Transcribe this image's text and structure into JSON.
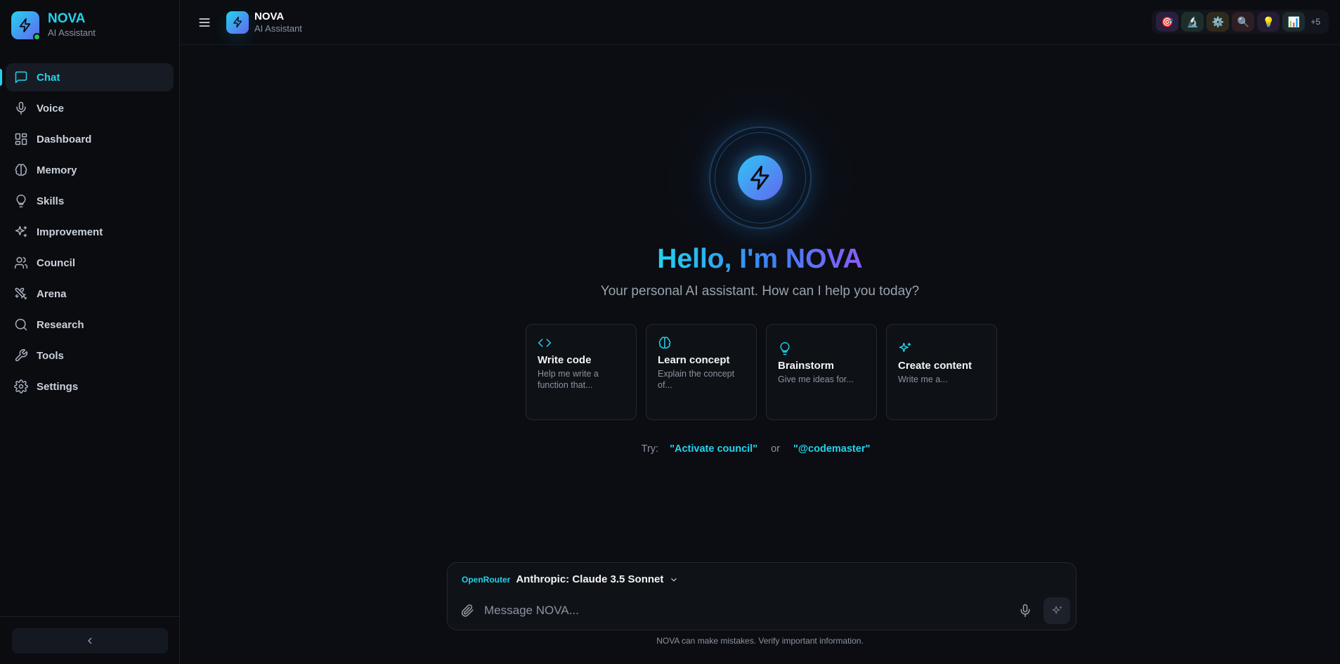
{
  "brand": {
    "title": "NOVA",
    "subtitle": "AI Assistant"
  },
  "sidebar": {
    "items": [
      {
        "label": "Chat",
        "icon": "message-square-icon",
        "active": true
      },
      {
        "label": "Voice",
        "icon": "mic-icon"
      },
      {
        "label": "Dashboard",
        "icon": "layout-grid-icon"
      },
      {
        "label": "Memory",
        "icon": "brain-icon"
      },
      {
        "label": "Skills",
        "icon": "lightbulb-icon"
      },
      {
        "label": "Improvement",
        "icon": "sparkles-icon"
      },
      {
        "label": "Council",
        "icon": "users-icon"
      },
      {
        "label": "Arena",
        "icon": "swords-icon"
      },
      {
        "label": "Research",
        "icon": "search-icon"
      },
      {
        "label": "Tools",
        "icon": "wrench-icon"
      },
      {
        "label": "Settings",
        "icon": "gear-icon"
      }
    ],
    "collapse_icon": "chevron-left-icon"
  },
  "topbar": {
    "title": "NOVA",
    "subtitle": "AI Assistant",
    "agents": [
      {
        "icon": "🎯",
        "bg": "#2a1f3d"
      },
      {
        "icon": "🔬",
        "bg": "#1d2e2a"
      },
      {
        "icon": "⚙️",
        "bg": "#2e2a1d"
      },
      {
        "icon": "🔍",
        "bg": "#2e1d24"
      },
      {
        "icon": "💡",
        "bg": "#251d33"
      },
      {
        "icon": "📊",
        "bg": "#1d2a2e"
      }
    ],
    "agents_more": "+5"
  },
  "hero": {
    "title": "Hello, I'm NOVA",
    "subtitle": "Your personal AI assistant. How can I help you today?"
  },
  "cards": [
    {
      "title": "Write code",
      "desc": "Help me write a function that...",
      "icon": "code-icon"
    },
    {
      "title": "Learn concept",
      "desc": "Explain the concept of...",
      "icon": "brain-icon"
    },
    {
      "title": "Brainstorm",
      "desc": "Give me ideas for...",
      "icon": "lightbulb-icon"
    },
    {
      "title": "Create content",
      "desc": "Write me a...",
      "icon": "sparkles-icon"
    }
  ],
  "try": {
    "label": "Try:",
    "cmd1": "\"Activate council\"",
    "or": "or",
    "cmd2": "\"@codemaster\""
  },
  "composer": {
    "provider": "OpenRouter",
    "model": "Anthropic: Claude 3.5 Sonnet",
    "placeholder": "Message NOVA...",
    "value": ""
  },
  "disclaimer": "NOVA can make mistakes. Verify important information.",
  "colors": {
    "accent": "#22d3ee",
    "accent2": "#6366f1",
    "background": "#0b0d12"
  }
}
